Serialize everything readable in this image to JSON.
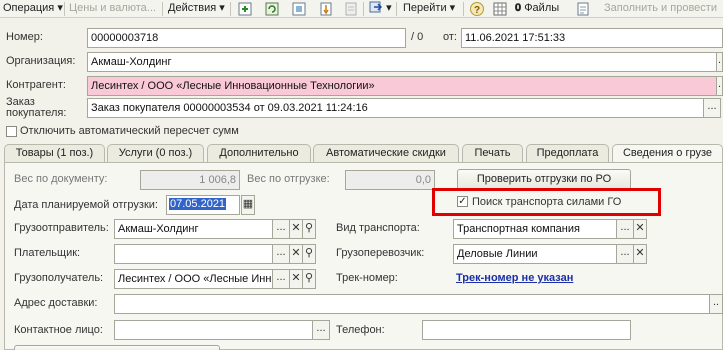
{
  "toolbar": {
    "operation": "Операция",
    "prices": "Цены и валюта...",
    "actions": "Действия",
    "goto": "Перейти",
    "files": "Файлы",
    "fill": "Заполнить и провести"
  },
  "header": {
    "number_label": "Номер:",
    "number_value": "00000003718",
    "number_suffix": "/ 0",
    "date_label": "от:",
    "date_value": "11.06.2021 17:51:33",
    "org_label": "Организация:",
    "org_value": "Акмаш-Холдинг",
    "contractor_label": "Контрагент:",
    "contractor_value": "Лесинтех / ООО «Лесные Инновационные Технологии»",
    "order_label_1": "Заказ",
    "order_label_2": "покупателя:",
    "order_value": "Заказ покупателя 00000003534 от 09.03.2021 11:24:16",
    "auto_recalc_label": "Отключить автоматический пересчет сумм"
  },
  "tabs": [
    {
      "label": "Товары (1 поз.)"
    },
    {
      "label": "Услуги (0 поз.)"
    },
    {
      "label": "Дополнительно"
    },
    {
      "label": "Автоматические скидки"
    },
    {
      "label": "Печать"
    },
    {
      "label": "Предоплата"
    },
    {
      "label": "Сведения о грузе"
    }
  ],
  "shipping": {
    "weight_doc_label": "Вес по документу:",
    "weight_doc_value": "1 006,8",
    "weight_ship_label": "Вес по отгрузке:",
    "weight_ship_value": "0,0",
    "check_button": "Проверить отгрузки по РО",
    "planned_date_label": "Дата планируемой отгрузки:",
    "planned_date_value": "07.05.2021",
    "transport_search_label": "Поиск транспорта силами ГО",
    "transport_search_checked": true,
    "shipper_label": "Грузоотправитель:",
    "shipper_value": "Акмаш-Холдинг",
    "transport_type_label": "Вид транспорта:",
    "transport_type_value": "Транспортная компания",
    "payer_label": "Плательщик:",
    "payer_value": "",
    "carrier_label": "Грузоперевозчик:",
    "carrier_value": "Деловые Линии",
    "consignee_label": "Грузополучатель:",
    "consignee_value": "Лесинтех / ООО «Лесные Инн",
    "track_label": "Трек-номер:",
    "track_value": "Трек-номер не указан",
    "address_label": "Адрес доставки:",
    "address_value": "",
    "contact_label": "Контактное лицо:",
    "contact_value": "",
    "phone_label": "Телефон:",
    "phone_value": ""
  },
  "colors": {
    "highlight": "#e00000",
    "required_field": "#f9c9d8",
    "link": "#1a2fa8"
  }
}
